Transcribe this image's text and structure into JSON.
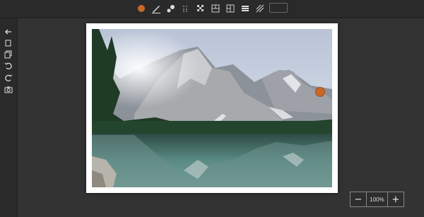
{
  "toolbar": {
    "tools": [
      {
        "name": "color-picker",
        "icon": "color-dot-icon",
        "color": "#c8682a"
      },
      {
        "name": "pen",
        "icon": "pen-icon"
      },
      {
        "name": "eraser",
        "icon": "eraser-icon"
      },
      {
        "name": "pattern-1",
        "icon": "grid-dots-icon"
      },
      {
        "name": "pattern-2",
        "icon": "checker-icon"
      },
      {
        "name": "pattern-3",
        "icon": "grid-hline-icon"
      },
      {
        "name": "pattern-4",
        "icon": "grid-split-icon"
      },
      {
        "name": "pattern-5",
        "icon": "grid-fill-icon"
      },
      {
        "name": "pattern-6",
        "icon": "diagonal-lines-icon"
      }
    ],
    "size_value": ""
  },
  "sidebar": {
    "items": [
      {
        "name": "back",
        "icon": "arrow-left-icon"
      },
      {
        "name": "copy",
        "icon": "copy-icon"
      },
      {
        "name": "duplicate",
        "icon": "duplicate-icon"
      },
      {
        "name": "undo",
        "icon": "undo-icon"
      },
      {
        "name": "redo",
        "icon": "redo-icon"
      },
      {
        "name": "snapshot",
        "icon": "camera-icon"
      }
    ]
  },
  "canvas": {
    "marker_color": "#c8682a"
  },
  "zoom": {
    "minus": "−",
    "value": "100%",
    "plus": "+"
  }
}
